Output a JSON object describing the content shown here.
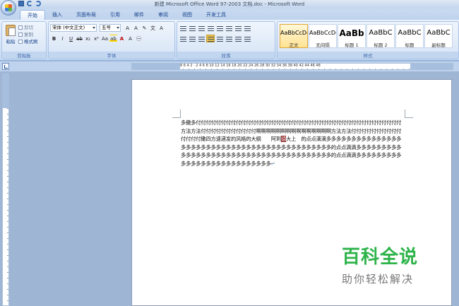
{
  "title": "新建 Microsoft Office Word 97-2003 文档.doc - Microsoft Word",
  "tabs": [
    "开始",
    "插入",
    "页面布局",
    "引用",
    "邮件",
    "审阅",
    "视图",
    "开发工具"
  ],
  "clipboard": {
    "paste": "粘贴",
    "cut": "剪切",
    "copy": "复制",
    "format_painter": "格式刷",
    "label": "剪贴板"
  },
  "font": {
    "name": "宋体 (中文正文)",
    "size": "五号",
    "label": "字体"
  },
  "paragraph": {
    "label": "段落"
  },
  "styles": {
    "label": "样式",
    "items": [
      {
        "sample": "AaBbCcDd",
        "name": "正文"
      },
      {
        "sample": "AaBbCcDd",
        "name": "无间隔"
      },
      {
        "sample": "AaBb",
        "name": "标题 1"
      },
      {
        "sample": "AaBbC",
        "name": "标题 2"
      },
      {
        "sample": "AaBbC",
        "name": "标题"
      },
      {
        "sample": "AaBbC",
        "name": "副标题"
      }
    ]
  },
  "ruler_numbers": "8  6  4  2  ·  2  4  6  8  10  12  14  16  18  20  22  24  26  28  30  32  34  36  38  40  42  44  46  48",
  "document": {
    "text_before": "多撒多付付付付付付付付付付付付付付付付付付付付付付付付付付付付付付付付付付付付付付付付付方法方法付付付付付付付付付付付啊啊啊啊啊啊啊啊啊啊啊啊啊啊啊方法方法付付付付付付付付付付付付付付撒四方速递发的风格的大纲　　阿到",
    "selected": "德",
    "text_after": "大上　的点点滴滴多多多多多多多多多多多多多多多多多多多多多多多多多多多多多多多多多多多多多多多多多多多多多的点点滴滴多多多多多多多多多多多多多多多多多多多多多多多多多多多多多多多多多多多多多多多的点点滴滴多多多多多多多多多多多多多多多多多多多多多多多多多多多",
    "end_mark": "↵"
  },
  "watermark": {
    "line1": "百科全说",
    "line2": "助你轻松解决"
  }
}
